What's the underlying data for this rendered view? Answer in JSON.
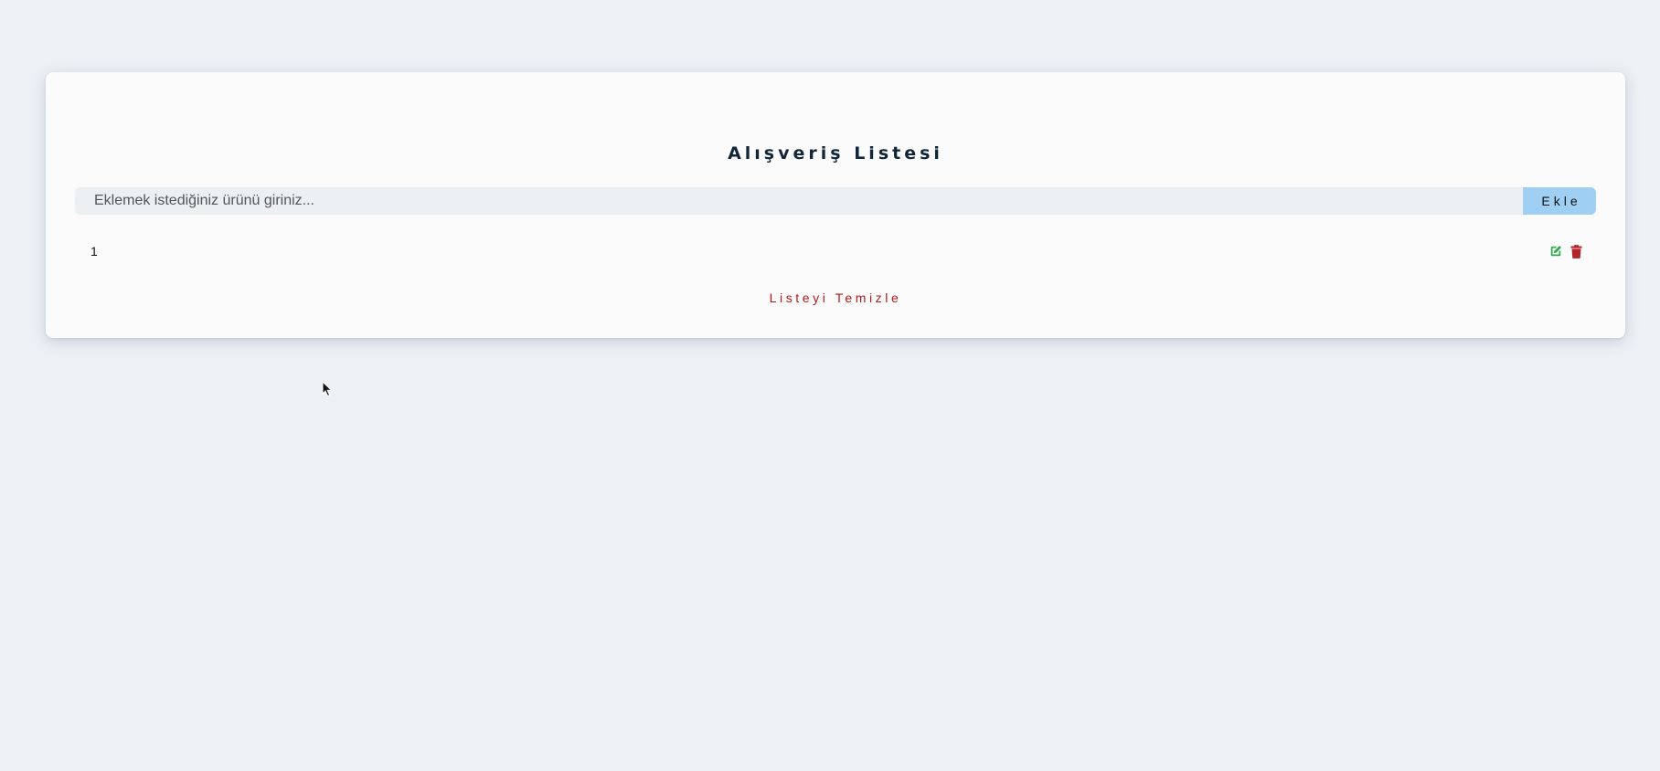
{
  "app": {
    "title": "Alışveriş Listesi"
  },
  "form": {
    "input_value": "",
    "input_placeholder": "Eklemek istediğiniz ürünü giriniz...",
    "add_label": "Ekle"
  },
  "list": {
    "items": [
      {
        "label": "1"
      }
    ]
  },
  "actions": {
    "clear_label": "Listeyi Temizle"
  },
  "icons": {
    "edit": "edit-icon",
    "delete": "trash-icon"
  },
  "colors": {
    "background": "#ecf1f5",
    "card": "#fbfbfc",
    "title": "#12263a",
    "input_bg": "#ecf0f3",
    "add_button": "#a0cff4",
    "edit_icon": "#2ea84a",
    "delete_icon": "#b3242b",
    "clear_text": "#b01818"
  }
}
